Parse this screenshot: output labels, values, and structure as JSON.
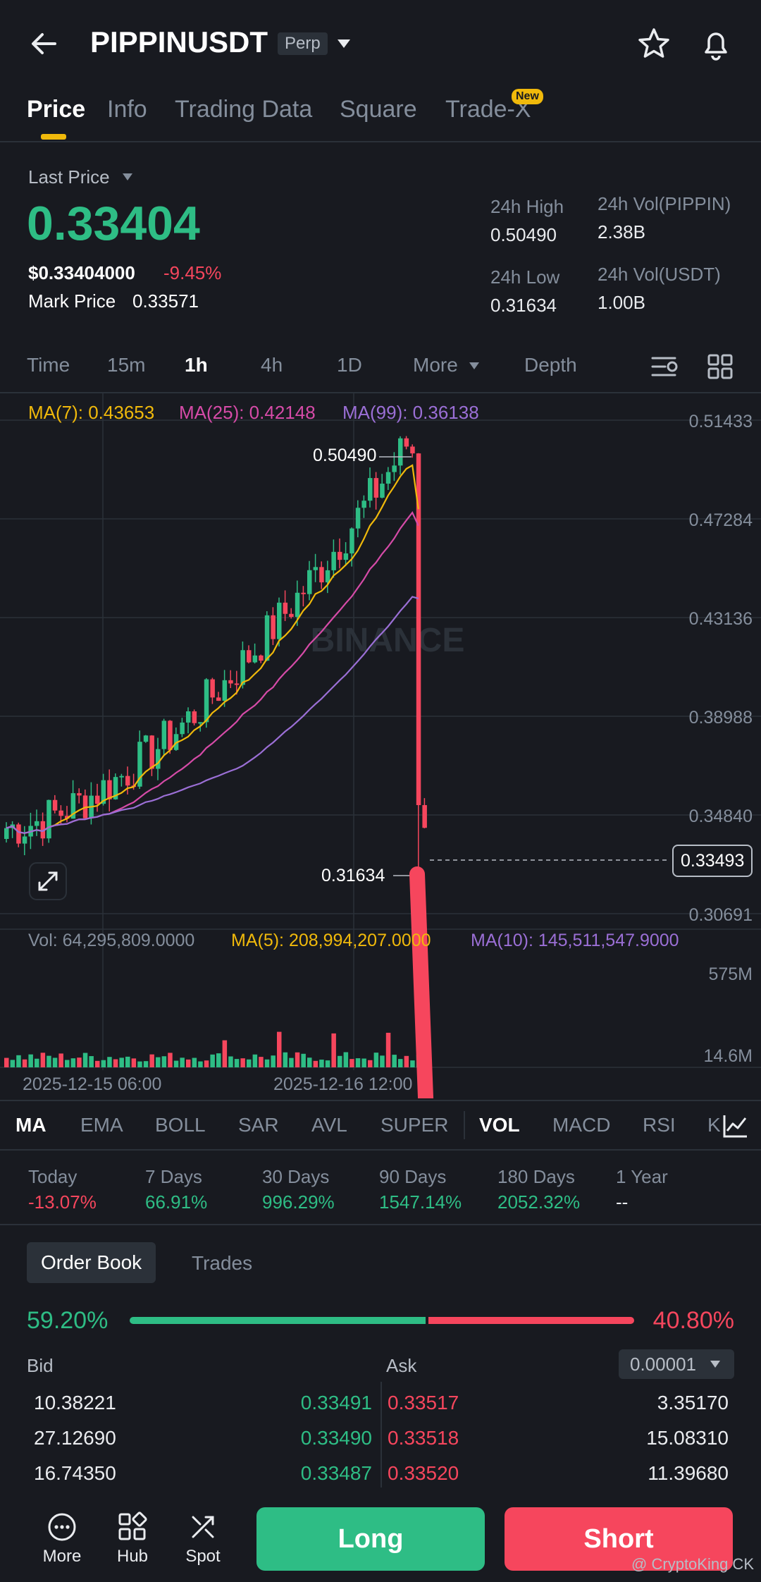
{
  "header": {
    "symbol": "PIPPINUSDT",
    "badge": "Perp",
    "icons": [
      "back-arrow-icon",
      "caret-down-icon",
      "star-icon",
      "bell-icon"
    ]
  },
  "tabs": [
    {
      "label": "Price",
      "active": true
    },
    {
      "label": "Info"
    },
    {
      "label": "Trading Data"
    },
    {
      "label": "Square"
    },
    {
      "label": "Trade-X",
      "badge": "New"
    }
  ],
  "price": {
    "last_price_label": "Last Price",
    "last_price": "0.33404",
    "usd_price": "$0.33404000",
    "change_pct": "-9.45%",
    "mark_label": "Mark Price",
    "mark_value": "0.33571"
  },
  "stats": {
    "high_label": "24h High",
    "high_value": "0.50490",
    "low_label": "24h Low",
    "low_value": "0.31634",
    "vol_base_label": "24h Vol(PIPPIN)",
    "vol_base_value": "2.38B",
    "vol_quote_label": "24h Vol(USDT)",
    "vol_quote_value": "1.00B"
  },
  "intervals": {
    "items": [
      "Time",
      "15m",
      "1h",
      "4h",
      "1D",
      "More",
      "Depth"
    ],
    "active": "1h"
  },
  "chart": {
    "ma7": "MA(7): 0.43653",
    "ma25": "MA(25): 0.42148",
    "ma99": "MA(99): 0.36138",
    "y_ticks": [
      "0.51433",
      "0.47284",
      "0.43136",
      "0.38988",
      "0.34840",
      "0.30691"
    ],
    "current_price_tag": "0.33493",
    "high_marker": "0.50490",
    "low_marker": "0.31634",
    "watermark": "BINANCE",
    "vol_label": "Vol: 64,295,809.0000",
    "vol_ma5": "MA(5): 208,994,207.0000",
    "vol_ma10": "MA(10): 145,511,547.9000",
    "vol_ticks": [
      "575M",
      "14.6M"
    ],
    "x_ticks": [
      "2025-12-15 06:00",
      "2025-12-16 12:00"
    ],
    "colors": {
      "up": "#2ebd85",
      "down": "#f6465d",
      "ma7": "#f0b90b",
      "ma25": "#d64ba8",
      "ma99": "#9b6fd6"
    }
  },
  "chart_data": {
    "type": "candlestick",
    "interval": "1h",
    "high": 0.5049,
    "low": 0.31634,
    "last": 0.33493,
    "ylim": [
      0.29,
      0.52
    ],
    "series": [
      {
        "name": "MA(7)",
        "last": 0.43653
      },
      {
        "name": "MA(25)",
        "last": 0.42148
      },
      {
        "name": "MA(99)",
        "last": 0.36138
      }
    ]
  },
  "indicators": {
    "items": [
      "MA",
      "EMA",
      "BOLL",
      "SAR",
      "AVL",
      "SUPER",
      "VOL",
      "MACD",
      "RSI",
      "K"
    ],
    "active_main": "MA",
    "active_sub": "VOL"
  },
  "performance": [
    {
      "label": "Today",
      "value": "-13.07%",
      "color": "#f6465d"
    },
    {
      "label": "7 Days",
      "value": "66.91%",
      "color": "#2ebd85"
    },
    {
      "label": "30 Days",
      "value": "996.29%",
      "color": "#2ebd85"
    },
    {
      "label": "90 Days",
      "value": "1547.14%",
      "color": "#2ebd85"
    },
    {
      "label": "180 Days",
      "value": "2052.32%",
      "color": "#2ebd85"
    },
    {
      "label": "1 Year",
      "value": "--",
      "color": "#eaecef"
    }
  ],
  "orderbook": {
    "tab_active": "Order Book",
    "tab_other": "Trades",
    "bid_pct": "59.20%",
    "ask_pct": "40.80%",
    "bid_ratio": 0.592,
    "bid_label": "Bid",
    "ask_label": "Ask",
    "tick_size": "0.00001",
    "rows": [
      {
        "bid_qty": "10.38221",
        "bid_price": "0.33491",
        "ask_price": "0.33517",
        "ask_qty": "3.35170"
      },
      {
        "bid_qty": "27.12690",
        "bid_price": "0.33490",
        "ask_price": "0.33518",
        "ask_qty": "15.08310"
      },
      {
        "bid_qty": "16.74350",
        "bid_price": "0.33487",
        "ask_price": "0.33520",
        "ask_qty": "11.39680"
      }
    ]
  },
  "bottom_bar": {
    "more": "More",
    "hub": "Hub",
    "spot": "Spot",
    "long": "Long",
    "short": "Short",
    "credit": "@ CryptoKing CK"
  }
}
